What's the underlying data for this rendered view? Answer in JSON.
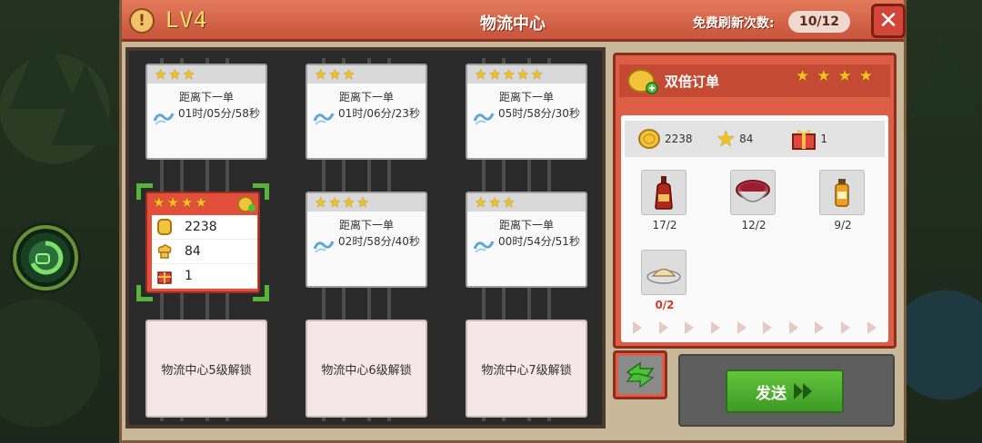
{
  "header": {
    "level": "LV4",
    "title": "物流中心",
    "refresh_label": "免费刷新次数:",
    "refresh_count": "10/12"
  },
  "slots": [
    {
      "stars": 3,
      "label": "距离下一单",
      "time": "01时/05分/58秒"
    },
    {
      "stars": 3,
      "label": "距离下一单",
      "time": "01时/06分/23秒"
    },
    {
      "stars": 5,
      "label": "距离下一单",
      "time": "05时/58分/30秒"
    },
    {
      "stars": 4,
      "label": "距离下一单",
      "time": "02时/58分/40秒"
    },
    {
      "stars": 3,
      "label": "距离下一单",
      "time": "00时/54分/51秒"
    }
  ],
  "selected_order": {
    "stars": 4,
    "coins": "2238",
    "exp": "84",
    "gifts": "1"
  },
  "locked": [
    "物流中心5级解锁",
    "物流中心6级解锁",
    "物流中心7级解锁"
  ],
  "detail": {
    "title": "双倍订单",
    "stars": 4,
    "reward_coins": "2238",
    "reward_exp": "84",
    "reward_gifts": "1",
    "items": [
      {
        "icon": "soy-sauce-bottle-icon",
        "count": "17/2"
      },
      {
        "icon": "soup-bowl-icon",
        "count": "12/2"
      },
      {
        "icon": "juice-bottle-icon",
        "count": "9/2"
      },
      {
        "icon": "flour-plate-icon",
        "count": "0/2"
      }
    ]
  },
  "send_label": "发送",
  "colors": {
    "accent_red": "#dd5e44",
    "send_green": "#4fb02f",
    "star_gold": "#f4c21e"
  }
}
